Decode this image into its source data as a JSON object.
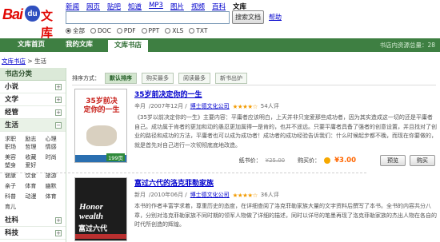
{
  "logo": {
    "text_bai": "Bai",
    "text_paw": "du",
    "text_wenku": "文库"
  },
  "topnav": [
    "新闻",
    "网页",
    "贴吧",
    "知道",
    "MP3",
    "图片",
    "视频",
    "百科",
    "文库"
  ],
  "search": {
    "value": "",
    "button": "搜索文档",
    "help": "帮助"
  },
  "filters": [
    {
      "label": "全部",
      "checked": true
    },
    {
      "label": "DOC",
      "checked": false
    },
    {
      "label": "PDF",
      "checked": false
    },
    {
      "label": "PPT",
      "checked": false
    },
    {
      "label": "XLS",
      "checked": false
    },
    {
      "label": "TXT",
      "checked": false
    }
  ],
  "navbar": {
    "tabs": [
      "文库首页",
      "我的文库",
      "文库书店"
    ],
    "count": "书店内资源总量：28"
  },
  "breadcrumb": {
    "root": "文库书店",
    "sep": " > ",
    "current": "生活"
  },
  "sidebar": {
    "heading": "书店分类",
    "rows": [
      "小说",
      "文学",
      "经管",
      "生活"
    ],
    "subs": [
      "求职职场",
      "励志哲理",
      "心理情感",
      "美容塑身",
      "收藏爱好",
      "时尚",
      "健康",
      "饮食",
      "旅游",
      "亲子",
      "体育",
      "幽默",
      "科普",
      "动漫",
      "体育",
      "育儿"
    ],
    "rows_after": [
      "社科",
      "科技"
    ]
  },
  "sort": {
    "label": "排序方式：",
    "buttons": [
      "默认排序",
      "购买最多",
      "阅读最多",
      "新书出炉"
    ]
  },
  "books": [
    {
      "title": "35岁前决定你的一生",
      "author": "辛月",
      "date": "/2007年12月 /",
      "publisher": "博士德文化公司",
      "stars": "★★★★☆",
      "reviews": "54人评",
      "desc": "《35岁以前决定你的一生》主要内容：平庸者应该明白，上天并非只宠爱那些成功者，因为其实造成这一切的还是平庸者自己。成功属于肯者的更加和动的愚忍更加属得一是肯的，也并不遥远。只要平庸者具备了强者的创意设置，并且找对了创业的路径和成功的方法，平庸者也可以成为成功者！成功者的成功经验告诉我们：什么时候起步都不晚，而现在你要做的，就是首先对自己进行一次彻彻底底地改造。",
      "cover_title": "35岁前决定你的一生",
      "cover_pages": "199页",
      "orig_label": "纸书价：",
      "orig_price": "¥25.00",
      "buy_label": "购买价：",
      "price": "¥3.00",
      "preview": "预览",
      "purchase": "购买"
    },
    {
      "title": "富过六代的洛克菲勒家族",
      "author": "新月",
      "date": "/2010年06月 /",
      "publisher": "博士德文化公司",
      "stars": "★★★★☆",
      "reviews": "36人评",
      "desc": "本书的作者丰富学求着，尊重历史的态度，在详细查阅了洛克菲勒家族大量的文字资料后撰写了本书。全书的内容共分八章，分别对洛克菲勒家族不同时期的领军人物做了详细的描述，同时以详尽的笔墨再现了洛克菲勒家族的杰出人物在各自的时代所创造的辉煌。",
      "cover_en": "Honor wealth",
      "cover_cn": "富过六代"
    }
  ]
}
